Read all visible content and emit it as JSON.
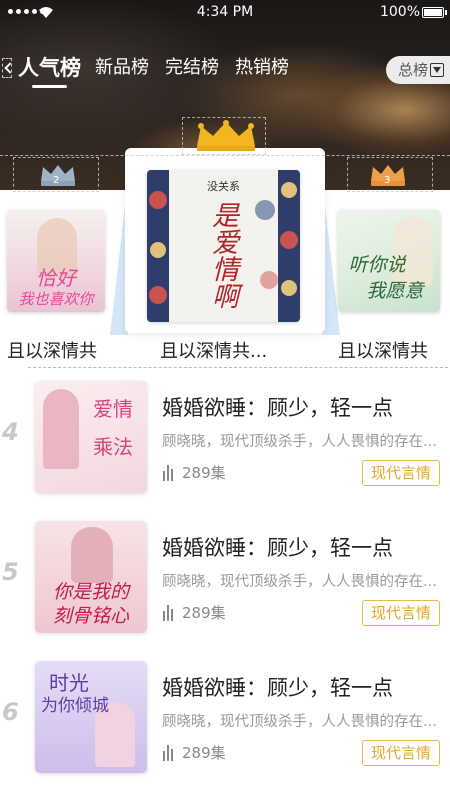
{
  "status_bar": {
    "time": "4:34 PM",
    "battery": "100%"
  },
  "nav": {
    "tabs": [
      {
        "label": "人气榜",
        "active": true
      },
      {
        "label": "新品榜",
        "active": false
      },
      {
        "label": "完结榜",
        "active": false
      },
      {
        "label": "热销榜",
        "active": false
      }
    ],
    "dropdown_label": "总榜"
  },
  "podium": {
    "first": {
      "rank": "1",
      "title": "且以深情共...",
      "cover_text": [
        "没关系",
        "是爱情啊"
      ],
      "cover_colors": {
        "accent": "#b3242a",
        "floral": "#2e3d6b"
      }
    },
    "second": {
      "rank": "2",
      "title": "且以深情共",
      "cover_text": [
        "恰好",
        "我也喜欢你"
      ]
    },
    "third": {
      "rank": "3",
      "title": "且以深情共",
      "cover_text": [
        "听你说",
        "我愿意"
      ]
    }
  },
  "list": [
    {
      "rank": "4",
      "title": "婚婚欲睡：顾少，轻一点",
      "desc": "顾晓晓，现代顶级杀手，人人畏惧的存在...",
      "episodes": "289集",
      "tag": "现代言情",
      "cover_text": [
        "爱情",
        "乘法"
      ]
    },
    {
      "rank": "5",
      "title": "婚婚欲睡：顾少，轻一点",
      "desc": "顾晓晓，现代顶级杀手，人人畏惧的存在...",
      "episodes": "289集",
      "tag": "现代言情",
      "cover_text": [
        "你是我的",
        "刻骨铭心"
      ]
    },
    {
      "rank": "6",
      "title": "婚婚欲睡：顾少，轻一点",
      "desc": "顾晓晓，现代顶级杀手，人人畏惧的存在...",
      "episodes": "289集",
      "tag": "现代言情",
      "cover_text": [
        "时光",
        "为你倾城"
      ]
    }
  ],
  "colors": {
    "tag_border": "#e9b84a",
    "crown_gold": "#f2b620",
    "crown_silver": "#9fb2c7",
    "crown_bronze": "#f0a04a"
  }
}
